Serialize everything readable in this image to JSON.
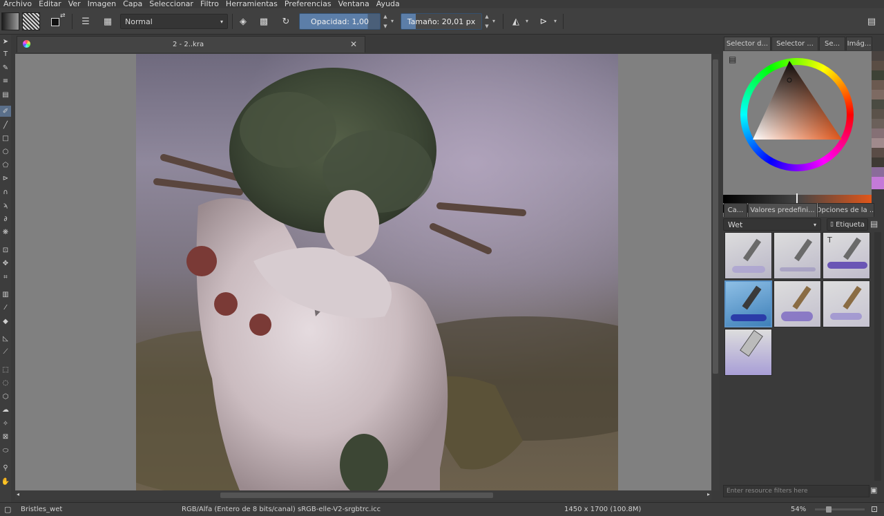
{
  "menu": [
    "Archivo",
    "Editar",
    "Ver",
    "Imagen",
    "Capa",
    "Seleccionar",
    "Filtro",
    "Herramientas",
    "Preferencias",
    "Ventana",
    "Ayuda"
  ],
  "toolbar": {
    "blend_mode": "Normal",
    "opacity_label": "Opacidad:",
    "opacity_value": "1,00",
    "size_label": "Tamaño:",
    "size_value": "20,01 px",
    "opacity_fill": 0.85,
    "size_fill": 0.18
  },
  "document": {
    "tab_title": "2 - 2..kra"
  },
  "dock": {
    "top_tabs": [
      "Selector d...",
      "Selector ...",
      "Se...",
      "Imág..."
    ],
    "preset_tabs": [
      "Ca...",
      "Valores predefini...",
      "Opciones de la ..."
    ],
    "brush_filter": "Wet",
    "tag_label": "Etiqueta",
    "resource_filter_placeholder": "Enter resource filters here"
  },
  "colors": {
    "accent": "#5c7ea8",
    "selected_brush": "#5c95c9"
  },
  "status": {
    "brush_name": "Bristles_wet",
    "color_profile": "RGB/Alfa (Entero de 8 bits/canal)  sRGB-elle-V2-srgbtrc.icc",
    "image_size": "1450 x 1700 (100.8M)",
    "zoom": "54%",
    "zoom_level": 0.54
  }
}
